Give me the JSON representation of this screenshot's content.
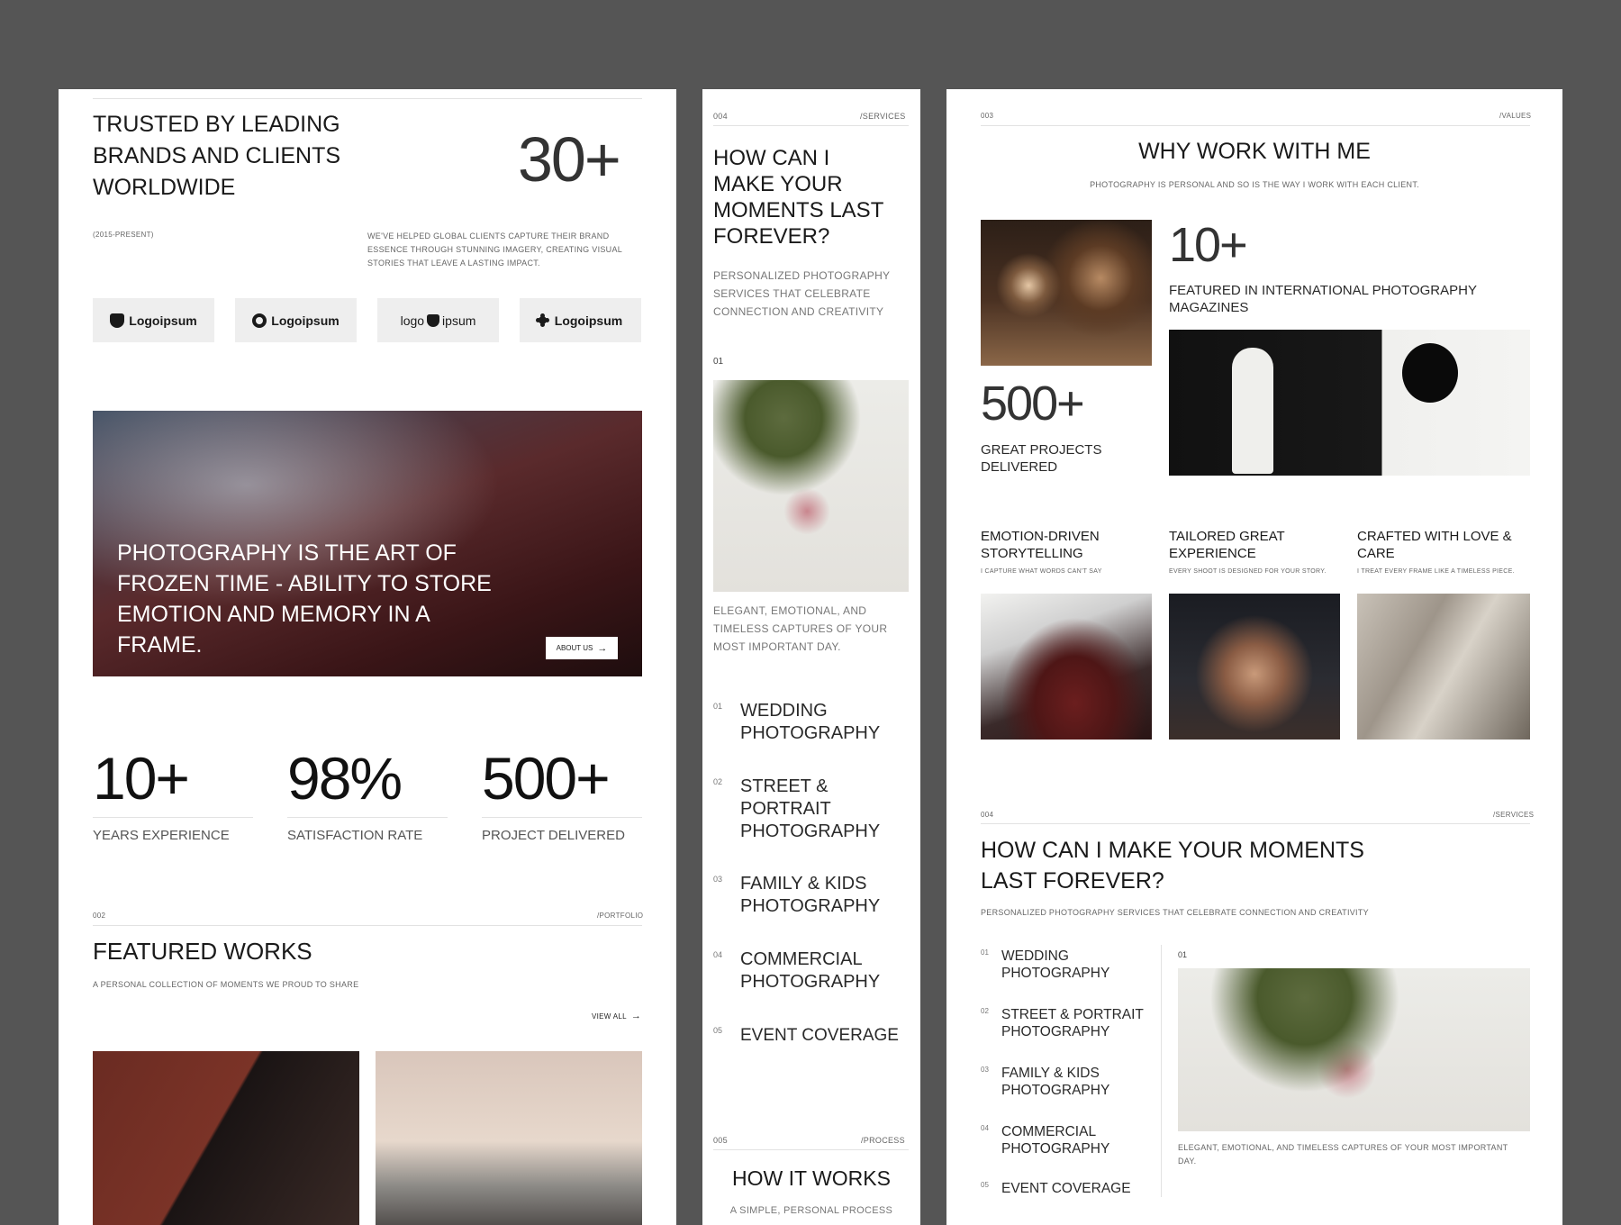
{
  "panel_a": {
    "trusted_heading": [
      "TRUSTED BY LEADING",
      "BRANDS AND CLIENTS",
      "WORLDWIDE"
    ],
    "big_number": "30+",
    "period": "(2015-PRESENT)",
    "trusted_desc": [
      "WE'VE HELPED GLOBAL CLIENTS CAPTURE THEIR BRAND",
      "ESSENCE THROUGH STUNNING IMAGERY, CREATING VISUAL",
      "STORIES THAT LEAVE A LASTING IMPACT."
    ],
    "logos": [
      "Logoipsum",
      "Logoipsum",
      "logo",
      "ipsum",
      "Logoipsum"
    ],
    "hero_quote": [
      "PHOTOGRAPHY IS THE ART OF",
      "FROZEN TIME - ABILITY TO STORE",
      "EMOTION AND MEMORY IN A",
      "FRAME."
    ],
    "about_button": "ABOUT US",
    "stats": [
      {
        "value": "10+",
        "label": "YEARS EXPERIENCE"
      },
      {
        "value": "98%",
        "label": "SATISFACTION RATE"
      },
      {
        "value": "500+",
        "label": "PROJECT DELIVERED"
      }
    ],
    "portfolio_index": "002",
    "portfolio_tag": "/PORTFOLIO",
    "featured_title": "FEATURED WORKS",
    "featured_sub": "A PERSONAL COLLECTION OF MOMENTS WE PROUD TO SHARE",
    "view_all": "VIEW ALL"
  },
  "panel_b": {
    "index": "004",
    "tag": "/SERVICES",
    "heading": [
      "HOW CAN I",
      "MAKE YOUR",
      "MOMENTS LAST",
      "FOREVER?"
    ],
    "sub": [
      "PERSONALIZED PHOTOGRAPHY",
      "SERVICES THAT CELEBRATE",
      "CONNECTION AND CREATIVITY"
    ],
    "image_index": "01",
    "caption": [
      "ELEGANT, EMOTIONAL, AND",
      "TIMELESS CAPTURES OF YOUR",
      "MOST IMPORTANT DAY."
    ],
    "services": [
      {
        "n": "01",
        "lines": [
          "WEDDING",
          "PHOTOGRAPHY"
        ]
      },
      {
        "n": "02",
        "lines": [
          "STREET &",
          "PORTRAIT",
          "PHOTOGRAPHY"
        ]
      },
      {
        "n": "03",
        "lines": [
          "FAMILY & KIDS",
          "PHOTOGRAPHY"
        ]
      },
      {
        "n": "04",
        "lines": [
          "COMMERCIAL",
          "PHOTOGRAPHY"
        ]
      },
      {
        "n": "05",
        "lines": [
          "EVENT COVERAGE"
        ]
      }
    ],
    "process_index": "005",
    "process_tag": "/PROCESS",
    "process_title": "HOW IT WORKS",
    "process_sub": "A SIMPLE, PERSONAL PROCESS"
  },
  "panel_c": {
    "index": "003",
    "tag": "/VALUES",
    "title": "WHY WORK WITH ME",
    "subtitle": "PHOTOGRAPHY IS PERSONAL AND SO IS THE WAY I WORK WITH EACH CLIENT.",
    "stat1_value": "10+",
    "stat1_label": [
      "FEATURED IN INTERNATIONAL PHOTOGRAPHY",
      "MAGAZINES"
    ],
    "stat2_value": "500+",
    "stat2_label": [
      "GREAT PROJECTS",
      "DELIVERED"
    ],
    "values": [
      {
        "title": [
          "EMOTION-DRIVEN",
          "STORYTELLING"
        ],
        "desc": "I CAPTURE WHAT WORDS CAN'T SAY"
      },
      {
        "title": [
          "TAILORED GREAT",
          "EXPERIENCE"
        ],
        "desc": "EVERY SHOOT IS DESIGNED FOR YOUR STORY."
      },
      {
        "title": [
          "CRAFTED WITH LOVE &",
          "CARE"
        ],
        "desc": "I TREAT EVERY FRAME LIKE A TIMELESS PIECE."
      }
    ],
    "services_index": "004",
    "services_tag": "/SERVICES",
    "services_heading": [
      "HOW CAN I MAKE YOUR MOMENTS",
      "LAST FOREVER?"
    ],
    "services_sub": "PERSONALIZED PHOTOGRAPHY SERVICES THAT CELEBRATE CONNECTION AND CREATIVITY",
    "services": [
      {
        "n": "01",
        "lines": [
          "WEDDING",
          "PHOTOGRAPHY"
        ]
      },
      {
        "n": "02",
        "lines": [
          "STREET & PORTRAIT",
          "PHOTOGRAPHY"
        ]
      },
      {
        "n": "03",
        "lines": [
          "FAMILY & KIDS",
          "PHOTOGRAPHY"
        ]
      },
      {
        "n": "04",
        "lines": [
          "COMMERCIAL",
          "PHOTOGRAPHY"
        ]
      },
      {
        "n": "05",
        "lines": [
          "EVENT COVERAGE"
        ]
      }
    ],
    "image_index": "01",
    "caption": [
      "ELEGANT, EMOTIONAL, AND TIMELESS CAPTURES OF YOUR MOST IMPORTANT",
      "DAY."
    ]
  }
}
